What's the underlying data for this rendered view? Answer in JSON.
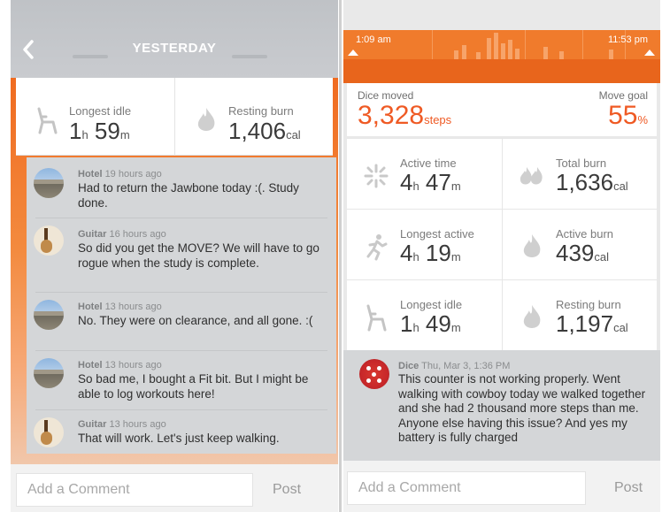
{
  "left": {
    "header_title": "YESTERDAY",
    "stats": [
      {
        "label": "Longest idle",
        "value_big": "1",
        "unit_1": "h",
        "value_big_2": " 59",
        "unit_2": "m",
        "icon": "chair-icon"
      },
      {
        "label": "Resting burn",
        "value_big": "1,406",
        "unit_1": "cal",
        "icon": "flame-icon"
      }
    ],
    "comments": [
      {
        "name": "Hotel",
        "time": "19 hours ago",
        "text": "Had to return the Jawbone today :(. Study done.",
        "avatar": "hotel-avatar"
      },
      {
        "name": "Guitar",
        "time": "16 hours ago",
        "text": "So did you get the MOVE? We will have to go rogue when the study is complete.",
        "avatar": "guitar-avatar"
      },
      {
        "name": "Hotel",
        "time": "13 hours ago",
        "text": "No. They were on clearance, and all gone. :(",
        "avatar": "hotel-avatar"
      },
      {
        "name": "Hotel",
        "time": "13 hours ago",
        "text": "So bad me, I bought a Fit bit. But I might be able to log workouts here!",
        "avatar": "hotel-avatar"
      },
      {
        "name": "Guitar",
        "time": "13 hours ago",
        "text": "That will work. Let's just keep walking.",
        "avatar": "guitar-avatar"
      }
    ],
    "comment_placeholder": "Add a Comment",
    "post_label": "Post"
  },
  "right": {
    "time_start": "1:09 am",
    "time_end": "11:53 pm",
    "moved_label": "Dice moved",
    "steps_value": "3,328",
    "steps_unit": "steps",
    "goal_label": "Move goal",
    "goal_value": "55",
    "goal_unit": "%",
    "stats": [
      {
        "label": "Active time",
        "n1": "4",
        "u1": "h",
        "n2": " 47",
        "u2": "m",
        "icon": "sparkle-icon"
      },
      {
        "label": "Total burn",
        "n1": "1,636",
        "u1": "cal",
        "n2": "",
        "u2": "",
        "icon": "double-flame-icon"
      },
      {
        "label": "Longest active",
        "n1": "4",
        "u1": "h",
        "n2": " 19",
        "u2": "m",
        "icon": "runner-icon"
      },
      {
        "label": "Active burn",
        "n1": "439",
        "u1": "cal",
        "n2": "",
        "u2": "",
        "icon": "flame-icon"
      },
      {
        "label": "Longest idle",
        "n1": "1",
        "u1": "h",
        "n2": " 49",
        "u2": "m",
        "icon": "chair-icon"
      },
      {
        "label": "Resting burn",
        "n1": "1,197",
        "u1": "cal",
        "n2": "",
        "u2": "",
        "icon": "flame-icon"
      }
    ],
    "comment": {
      "name": "Dice",
      "time": "Thu, Mar 3, 1:36 PM",
      "text": "This counter is not working properly. Went walking with cowboy today we walked together and she had 2 thousand more steps than me. Anyone else having this issue? And yes my battery is fully charged"
    },
    "comment_placeholder": "Add a Comment",
    "post_label": "Post"
  },
  "colors": {
    "accent": "#ef5a24",
    "timeline": "#f07b2c",
    "header_gray": "#c4c6ca",
    "comment_bg": "#d4d6d8"
  }
}
